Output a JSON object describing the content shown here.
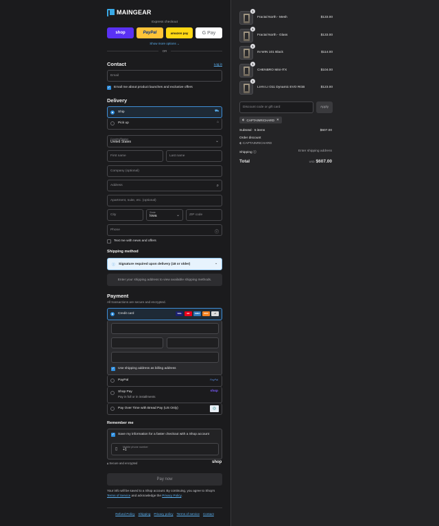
{
  "brand": {
    "name": "MAINGEAR"
  },
  "express": {
    "title": "Express checkout",
    "buttons": [
      {
        "label": "shop"
      },
      {
        "label": "PayPal"
      },
      {
        "label": "amazon pay"
      },
      {
        "label": "G Pay"
      }
    ],
    "more": "Show more options",
    "more_chevron": "chevron-down-icon",
    "or": "OR"
  },
  "contact": {
    "title": "Contact",
    "login": "Log in",
    "email_placeholder": "Email",
    "email_optin": "Email me about product launches and exclusive offers"
  },
  "delivery": {
    "title": "Delivery",
    "options": [
      {
        "label": "Ship",
        "icon": "truck-icon"
      },
      {
        "label": "Pick up",
        "icon": "store-icon"
      }
    ],
    "country_label": "Country/Region",
    "country_value": "United States",
    "first_name": "First name",
    "last_name": "Last name",
    "company": "Company (optional)",
    "address": "Address",
    "apartment": "Apartment, suite, etc. (optional)",
    "city": "City",
    "state_label": "State",
    "state_value": "Iowa",
    "zip": "ZIP code",
    "phone": "Phone",
    "text_optin": "Text me with news and offers"
  },
  "shipping": {
    "title": "Shipping method",
    "notice": "Signature required upon delivery (18 or older)",
    "placeholder": "Enter your shipping address to view available shipping methods."
  },
  "payment": {
    "title": "Payment",
    "subtitle": "All transactions are secure and encrypted.",
    "credit_card": "Credit card",
    "card_logos": [
      {
        "label": "VISA",
        "color": "#1a1f71"
      },
      {
        "label": "MC",
        "color": "#eb001b"
      },
      {
        "label": "AMEX",
        "color": "#2e77bb"
      },
      {
        "label": "DISC",
        "color": "#f58220"
      },
      {
        "label": "+3",
        "color": "#dddddd"
      }
    ],
    "billing_same": "Use shipping address as billing address",
    "methods": [
      {
        "label": "PayPal",
        "tag": "PayPal"
      },
      {
        "label": "Shop Pay",
        "sub": "Pay in full or in installments",
        "tag": "shop"
      },
      {
        "label": "Pay Over Time with Bread Pay (US Only)"
      }
    ]
  },
  "remember": {
    "title": "Remember me",
    "save": "Save my information for a faster checkout with a Shop account",
    "mobile_label": "Mobile phone number",
    "mobile_value": "+1",
    "secure": "Secure and encrypted",
    "shop": "shop"
  },
  "pay_now": "Pay now",
  "legal": {
    "text1": "Your info will be saved to a Shop account. By continuing, you agree to Shop's",
    "terms": "Terms of Service",
    "text2": "and acknowledge the",
    "privacy": "Privacy Policy"
  },
  "footer": [
    "Refund Policy",
    "Shipping",
    "Privacy policy",
    "Terms of service",
    "Contact"
  ],
  "cart": {
    "items": [
      {
        "qty": "1",
        "name": "Fractal North - Mesh",
        "price": "$133.00"
      },
      {
        "qty": "1",
        "name": "Fractal North - Glass",
        "price": "$133.00"
      },
      {
        "qty": "1",
        "name": "IN WIN 101 Black",
        "price": "$114.00"
      },
      {
        "qty": "1",
        "name": "CHENBRO Mini-ITX",
        "price": "$104.00"
      },
      {
        "qty": "1",
        "name": "LIAN LI O11 Dynamic EVO RGB",
        "price": "$123.00"
      }
    ],
    "discount_placeholder": "Discount code or gift card",
    "apply": "Apply",
    "code": "CAPTAINRICHARD",
    "subtotal_label": "Subtotal · 5 items",
    "subtotal": "$607.00",
    "order_discount": "Order discount",
    "discount_code": "CAPTAINRICHARD",
    "shipping_label": "Shipping",
    "shipping_value": "Enter shipping address",
    "total_label": "Total",
    "currency": "USD",
    "total": "$607.00"
  }
}
